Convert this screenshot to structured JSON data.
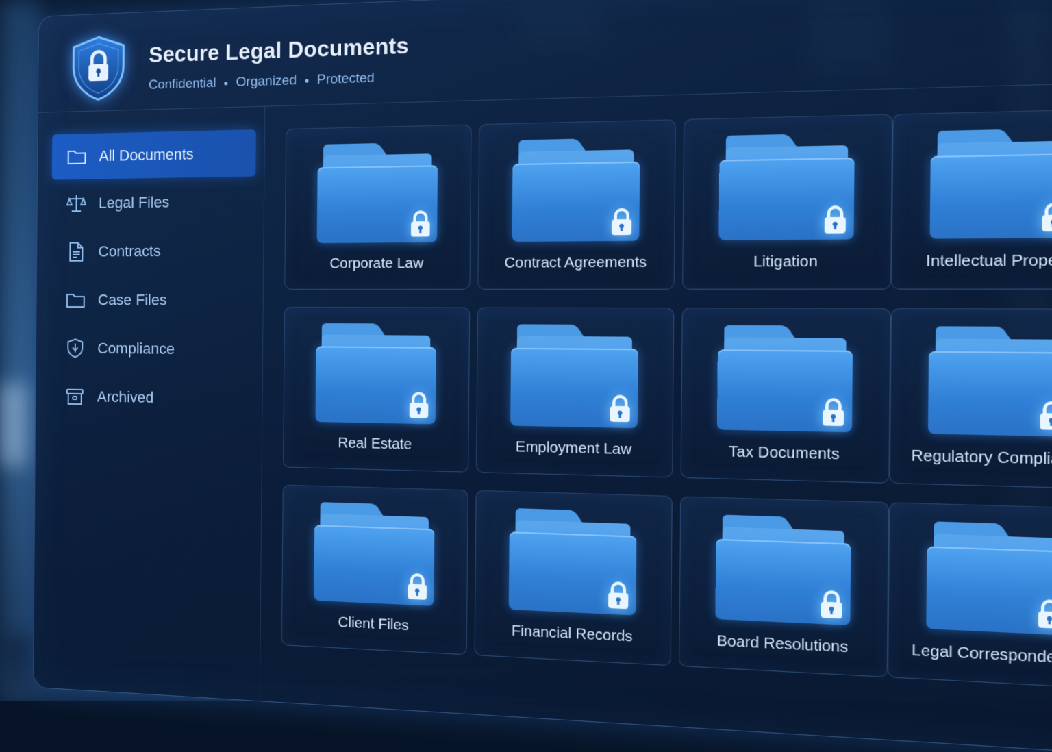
{
  "header": {
    "title": "Secure Legal Documents",
    "tagline": [
      "Confidential",
      "Organized",
      "Protected"
    ]
  },
  "sidebar": {
    "items": [
      {
        "label": "All Documents",
        "icon": "folder-icon",
        "active": true
      },
      {
        "label": "Legal Files",
        "icon": "scales-icon",
        "active": false
      },
      {
        "label": "Contracts",
        "icon": "document-icon",
        "active": false
      },
      {
        "label": "Case Files",
        "icon": "folder-icon",
        "active": false
      },
      {
        "label": "Compliance",
        "icon": "shield-icon",
        "active": false
      },
      {
        "label": "Archived",
        "icon": "archive-box-icon",
        "active": false
      }
    ]
  },
  "folders": [
    {
      "label": "Corporate Law",
      "locked": true
    },
    {
      "label": "Contract Agreements",
      "locked": true
    },
    {
      "label": "Litigation",
      "locked": true
    },
    {
      "label": "Intellectual Property",
      "locked": true
    },
    {
      "label": "Real Estate",
      "locked": true
    },
    {
      "label": "Employment Law",
      "locked": true
    },
    {
      "label": "Tax Documents",
      "locked": true
    },
    {
      "label": "Regulatory Compliance",
      "locked": true
    },
    {
      "label": "Client Files",
      "locked": true
    },
    {
      "label": "Financial Records",
      "locked": true
    },
    {
      "label": "Board Resolutions",
      "locked": true
    },
    {
      "label": "Legal Correspondence",
      "locked": true
    }
  ],
  "colors": {
    "accent": "#1c5cc4",
    "folder": "#3a8ee2",
    "text": "#d6e8fb"
  }
}
